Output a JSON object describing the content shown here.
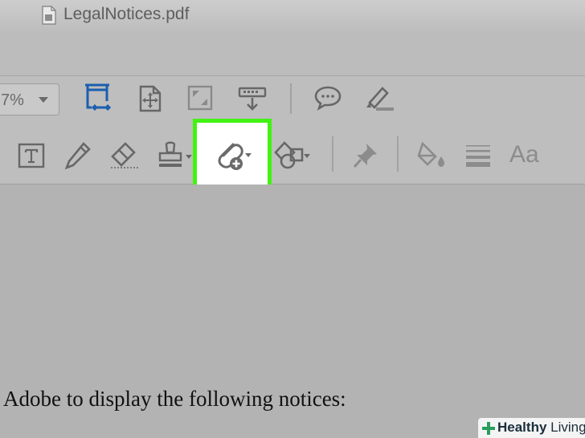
{
  "window": {
    "file_name": "LegalNotices.pdf"
  },
  "toolbar_top": {
    "zoom_value": "7%",
    "icons": [
      "page-size-icon",
      "organize-pages-icon",
      "full-screen-icon",
      "scan-download-icon",
      "comment-icon",
      "highlight-pen-icon"
    ]
  },
  "toolbar_annotate": {
    "icons": [
      "text-box-icon",
      "pencil-icon",
      "eraser-icon",
      "stamp-icon",
      "attach-file-icon",
      "shapes-icon",
      "pin-icon",
      "fill-color-icon",
      "line-weight-icon",
      "font-size-icon"
    ],
    "highlighted_tool": "attach-file-icon",
    "font_label": "Aa"
  },
  "document": {
    "visible_text": "Adobe to display the following notices:"
  },
  "watermark": {
    "brand_bold": "Healthy",
    "brand_light": " Living"
  },
  "colors": {
    "highlight_border": "#42f212",
    "accent_blue": "#1b5fae",
    "logo_green": "#2a9d5c"
  }
}
